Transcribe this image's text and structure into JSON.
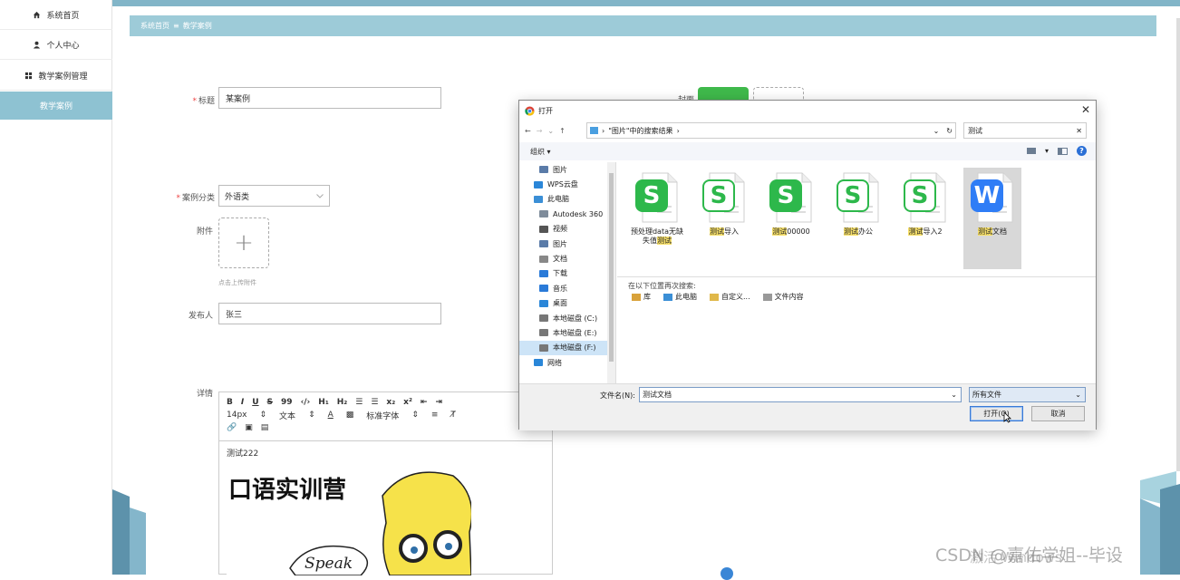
{
  "sidebar": {
    "items": [
      {
        "label": "系统首页",
        "icon": "home-icon"
      },
      {
        "label": "个人中心",
        "icon": "user-icon"
      },
      {
        "label": "教学案例管理",
        "icon": "grid-icon"
      },
      {
        "label": "教学案例",
        "icon": "",
        "active": true
      }
    ]
  },
  "breadcrumb": {
    "home": "系统首页",
    "separator": "≡",
    "current": "教学案例"
  },
  "form": {
    "title_label": "标题",
    "title_value": "某案例",
    "cover_label": "封面",
    "category_label": "案例分类",
    "category_value": "外语类",
    "attachment_label": "附件",
    "attachment_hint": "点击上传附件",
    "publisher_label": "发布人",
    "publisher_value": "张三",
    "detail_label": "详情"
  },
  "editor": {
    "toolbar_row1": [
      "B",
      "I",
      "U",
      "S",
      "99",
      "‹/›",
      "H₁",
      "H₂",
      "☰",
      "☰",
      "x₂",
      "x²",
      "⇤",
      "⇥"
    ],
    "font_size": "14px",
    "text_style": "文本",
    "font_family": "标准字体",
    "content_text": "测试222",
    "image_title": "口语实训营",
    "image_bubble": "Speak"
  },
  "dialog": {
    "title": "打开",
    "address": "\"图片\"中的搜索结果",
    "search_value": "测试",
    "organize": "组织 ▾",
    "nav_items": [
      {
        "label": "图片",
        "icon": "pictures-icon"
      },
      {
        "label": "WPS云盘",
        "icon": "cloud-icon"
      },
      {
        "label": "此电脑",
        "icon": "computer-icon"
      },
      {
        "label": "Autodesk 360",
        "icon": "autodesk-icon"
      },
      {
        "label": "视频",
        "icon": "video-icon"
      },
      {
        "label": "图片",
        "icon": "pictures-icon"
      },
      {
        "label": "文档",
        "icon": "document-icon"
      },
      {
        "label": "下载",
        "icon": "download-icon"
      },
      {
        "label": "音乐",
        "icon": "music-icon"
      },
      {
        "label": "桌面",
        "icon": "desktop-icon"
      },
      {
        "label": "本地磁盘 (C:)",
        "icon": "drive-icon"
      },
      {
        "label": "本地磁盘 (E:)",
        "icon": "drive-icon"
      },
      {
        "label": "本地磁盘 (F:)",
        "icon": "drive-icon",
        "selected": true
      },
      {
        "label": "网络",
        "icon": "network-icon"
      }
    ],
    "files": [
      {
        "pre": "预处理data无缺失值",
        "hl": "测试",
        "post": "",
        "type": "wps-sheet"
      },
      {
        "pre": "",
        "hl": "测试",
        "post": "导入",
        "type": "wps-sheet-outline"
      },
      {
        "pre": "",
        "hl": "测试",
        "post": "00000",
        "type": "wps-sheet"
      },
      {
        "pre": "",
        "hl": "测试",
        "post": "办公",
        "type": "wps-sheet-outline"
      },
      {
        "pre": "",
        "hl": "测试",
        "post": "导入2",
        "type": "wps-sheet-outline"
      },
      {
        "pre": "",
        "hl": "测试",
        "post": "文档",
        "type": "wps-writer",
        "selected": true
      }
    ],
    "search_again": "在以下位置再次搜索:",
    "search_locations": [
      {
        "label": "库",
        "icon": "library-icon"
      },
      {
        "label": "此电脑",
        "icon": "computer-icon"
      },
      {
        "label": "自定义...",
        "icon": "folder-icon"
      },
      {
        "label": "文件内容",
        "icon": "file-content-icon"
      }
    ],
    "filename_label": "文件名(N):",
    "filename_value": "测试文档",
    "filetype_value": "所有文件",
    "open_button": "打开(O)",
    "cancel_button": "取消"
  },
  "watermark": {
    "text1": "激活 Windows",
    "text2": "CSDN @嘉佑学姐--毕设"
  },
  "colors": {
    "accent": "#8ec2d2",
    "breadcrumb": "#9dcbd8",
    "topbar": "#82b5c8",
    "wps_green": "#2db84b",
    "wps_blue": "#2f7df6"
  }
}
